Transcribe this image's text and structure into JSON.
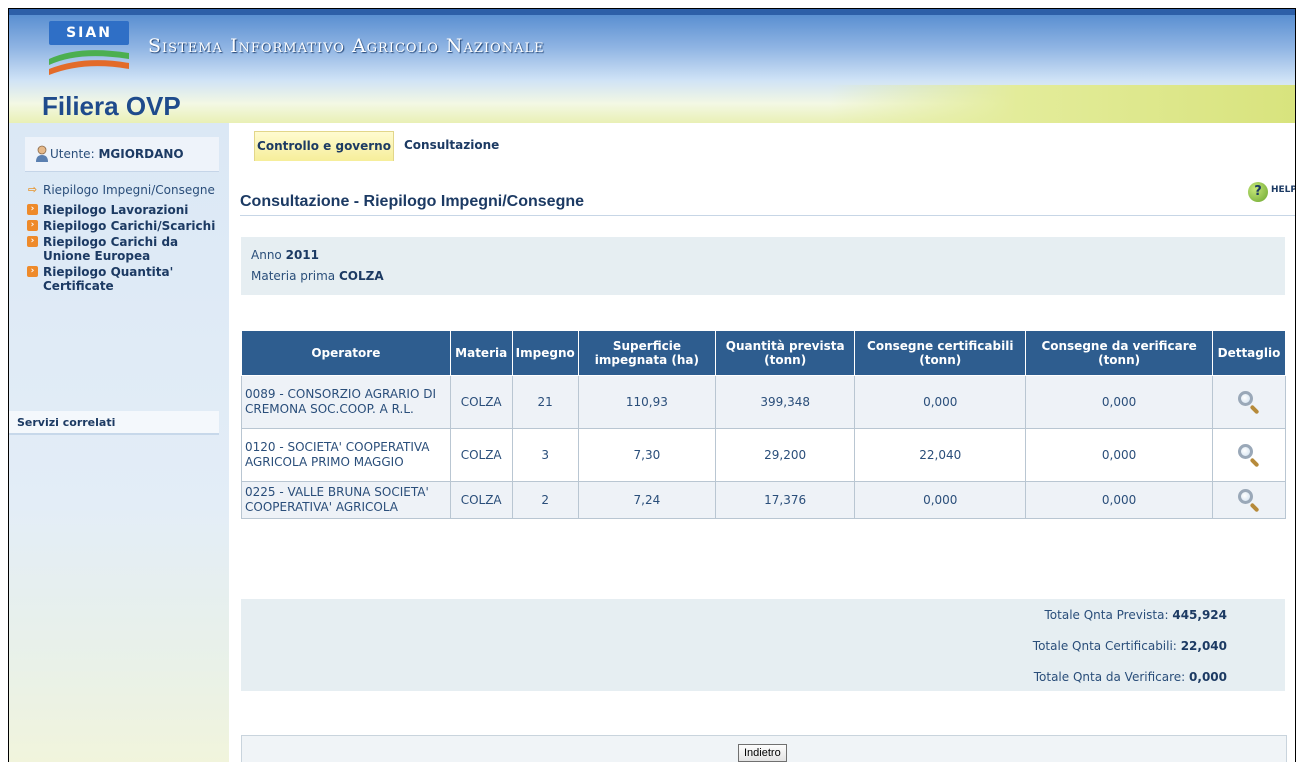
{
  "header": {
    "logo_text": "SIAN",
    "system_name": "Sistema Informativo Agricolo Nazionale",
    "app_title": "Filiera OVP"
  },
  "sidebar": {
    "user_label": "Utente:",
    "user_name": "MGIORDANO",
    "items": [
      {
        "label": "Riepilogo Impegni/Consegne"
      },
      {
        "label": "Riepilogo Lavorazioni"
      },
      {
        "label": "Riepilogo Carichi/Scarichi"
      },
      {
        "label": "Riepilogo Carichi da Unione Europea"
      },
      {
        "label": "Riepilogo Quantita' Certificate"
      }
    ],
    "related_services": "Servizi correlati"
  },
  "tabs": [
    {
      "label": "Controllo e governo"
    },
    {
      "label": "Consultazione"
    }
  ],
  "page": {
    "title": "Consultazione - Riepilogo Impegni/Consegne",
    "help_label": "HELP"
  },
  "info": {
    "anno_label": "Anno",
    "anno_value": "2011",
    "materia_label": "Materia prima",
    "materia_value": "COLZA"
  },
  "table": {
    "headers": [
      "Operatore",
      "Materia",
      "Impegno",
      "Superficie impegnata (ha)",
      "Quantità prevista (tonn)",
      "Consegne certificabili (tonn)",
      "Consegne da verificare (tonn)",
      "Dettaglio"
    ],
    "rows": [
      {
        "operatore": "0089 - CONSORZIO AGRARIO DI CREMONA SOC.COOP. A R.L.",
        "materia": "COLZA",
        "impegno": "21",
        "superficie": "110,93",
        "quantita": "399,348",
        "certificabili": "0,000",
        "da_verificare": "0,000"
      },
      {
        "operatore": "0120 - SOCIETA' COOPERATIVA AGRICOLA PRIMO MAGGIO",
        "materia": "COLZA",
        "impegno": "3",
        "superficie": "7,30",
        "quantita": "29,200",
        "certificabili": "22,040",
        "da_verificare": "0,000"
      },
      {
        "operatore": "0225 - VALLE BRUNA SOCIETA' COOPERATIVA' AGRICOLA",
        "materia": "COLZA",
        "impegno": "2",
        "superficie": "7,24",
        "quantita": "17,376",
        "certificabili": "0,000",
        "da_verificare": "0,000"
      }
    ]
  },
  "totals": {
    "prevista_label": "Totale Qnta Prevista:",
    "prevista_value": "445,924",
    "certificabili_label": "Totale Qnta Certificabili:",
    "certificabili_value": "22,040",
    "verificare_label": "Totale Qnta da Verificare:",
    "verificare_value": "0,000"
  },
  "buttons": {
    "back": "Indietro"
  },
  "colors": {
    "table_header": "#2e5d8f",
    "title": "#1c3a63",
    "bullet": "#ee8a2a",
    "active_tab": "#f6ee9a"
  },
  "icons": {
    "detail": "magnifier-icon",
    "help": "help-icon",
    "user": "user-icon"
  }
}
